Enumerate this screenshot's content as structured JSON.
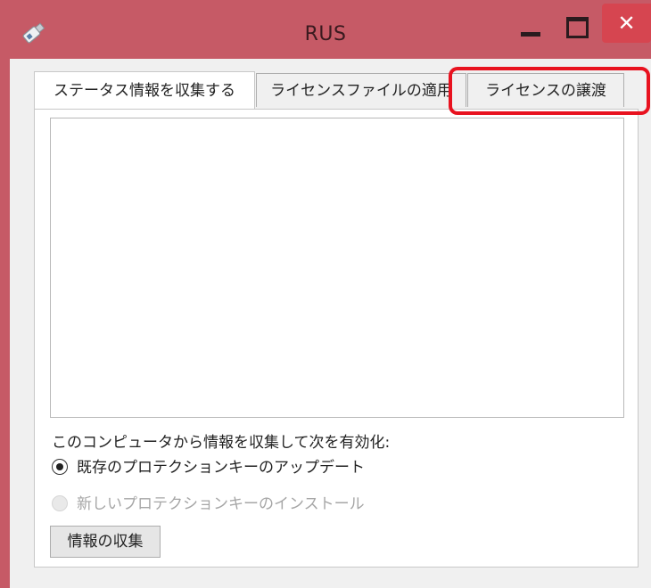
{
  "window": {
    "title": "RUS",
    "close_glyph": "✕",
    "frame_color": "#c65a66",
    "close_color": "#d64550"
  },
  "icons": {
    "app": "usb-key-icon",
    "minimize": "minimize-icon",
    "maximize": "maximize-icon",
    "close": "close-icon",
    "radio_selected": "radio-selected-icon",
    "radio_disabled": "radio-disabled-icon"
  },
  "tabs": [
    {
      "label": "ステータス情報を収集する",
      "active": true
    },
    {
      "label": "ライセンスファイルの適用",
      "active": false
    },
    {
      "label": "ライセンスの譲渡",
      "active": false
    }
  ],
  "main": {
    "info_text": "",
    "description": "このコンピュータから情報を収集して次を有効化:",
    "options": [
      {
        "label": "既存のプロテクションキーのアップデート",
        "selected": true,
        "enabled": true
      },
      {
        "label": "新しいプロテクションキーのインストール",
        "selected": false,
        "enabled": false
      }
    ],
    "collect_button": "情報の収集"
  },
  "annotation": {
    "color": "#e8121f",
    "target": "ライセンスの譲渡"
  }
}
